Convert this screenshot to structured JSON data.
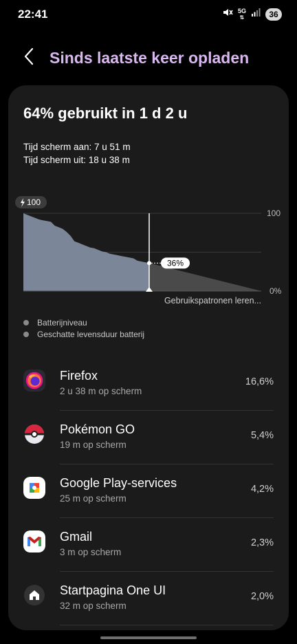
{
  "status_bar": {
    "time": "22:41",
    "network": "5G",
    "battery": "36"
  },
  "header": {
    "back_icon": "chevron-left-icon",
    "title": "Sinds laatste keer opladen"
  },
  "summary": {
    "title": "64% gebruikt in 1 d 2 u",
    "screen_on": "Tijd scherm aan: 7 u 51 m",
    "screen_off": "Tijd scherm uit: 18 u 38 m"
  },
  "chart_data": {
    "type": "area",
    "start_badge": "100",
    "y_max_label": "100",
    "y_min_label": "0%",
    "current_value_label": "36%",
    "forecast_label": "Gebruikspatronen leren...",
    "ylim": [
      0,
      100
    ],
    "grid": true,
    "battery_level": [
      100,
      98,
      96,
      94,
      92,
      91,
      90,
      89,
      84,
      82,
      80,
      76,
      71,
      64,
      62,
      60,
      58,
      56,
      55,
      53,
      51,
      50,
      48,
      47,
      46,
      45,
      44,
      43,
      42,
      39,
      38,
      37,
      36
    ],
    "estimated_remaining": [
      36,
      0
    ],
    "series": [
      {
        "name": "Batterijniveau",
        "color": "#7b8799"
      },
      {
        "name": "Geschatte levensduur batterij",
        "color": "#4a4a4a"
      }
    ]
  },
  "legend": {
    "items": [
      "Batterijniveau",
      "Geschatte levensduur batterij"
    ]
  },
  "apps": [
    {
      "name": "Firefox",
      "screen_time": "2 u 38 m op scherm",
      "percent": "16,6%",
      "icon": "firefox-icon"
    },
    {
      "name": "Pokémon GO",
      "screen_time": "19 m op scherm",
      "percent": "5,4%",
      "icon": "pokeball-icon"
    },
    {
      "name": "Google Play-services",
      "screen_time": "25 m op scherm",
      "percent": "4,2%",
      "icon": "google-play-services-icon"
    },
    {
      "name": "Gmail",
      "screen_time": "3 m op scherm",
      "percent": "2,3%",
      "icon": "gmail-icon"
    },
    {
      "name": "Startpagina One UI",
      "screen_time": "32 m op scherm",
      "percent": "2,0%",
      "icon": "home-icon"
    }
  ],
  "colors": {
    "title_accent": "#d9b8f0",
    "card_background": "#1b1b1b",
    "chart_fill": "#7b8799",
    "forecast_fill": "#4a4a4a"
  }
}
